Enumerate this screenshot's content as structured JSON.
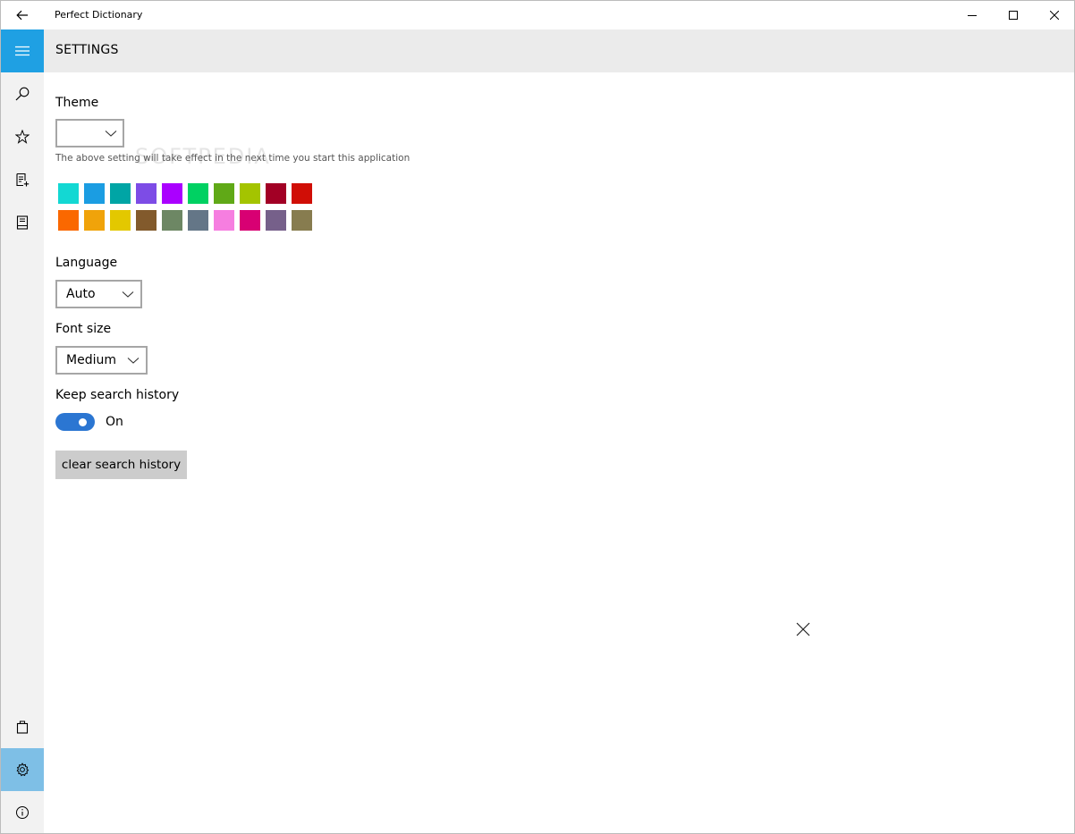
{
  "window": {
    "title": "Perfect Dictionary"
  },
  "header": {
    "title": "SETTINGS"
  },
  "settings": {
    "theme": {
      "label": "Theme",
      "selected": "",
      "note": "The above setting will take effect in the next time you start this application"
    },
    "accent_colors": [
      "#13d8d3",
      "#1b9de2",
      "#00a5a5",
      "#7d4ce6",
      "#aa00ff",
      "#00d162",
      "#60a917",
      "#a4c400",
      "#a20025",
      "#d00e06",
      "#fa6800",
      "#f0a30a",
      "#e3c800",
      "#825a2c",
      "#6d8764",
      "#647687",
      "#f67ee0",
      "#d80073",
      "#76608a",
      "#877c4f"
    ],
    "language": {
      "label": "Language",
      "selected": "Auto"
    },
    "font_size": {
      "label": "Font size",
      "selected": "Medium"
    },
    "search_history": {
      "label": "Keep search history",
      "state": "On",
      "clear_button": "clear search history"
    }
  },
  "watermark": "SOFTPEDIA",
  "icons": {
    "back": "back-arrow-icon",
    "hamburger": "hamburger-icon",
    "search": "search-icon",
    "favorites": "star-icon",
    "add_book": "add-book-icon",
    "book": "book-icon",
    "store": "store-bag-icon",
    "settings": "gear-icon",
    "about": "info-icon",
    "close": "close-icon"
  }
}
